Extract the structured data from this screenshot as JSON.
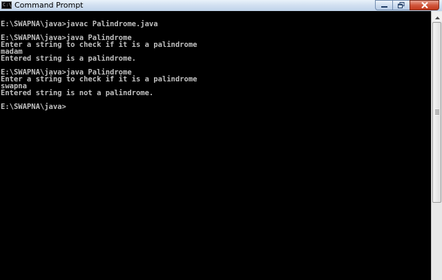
{
  "window": {
    "title": "Command Prompt",
    "icon_text": "C:\\",
    "controls": {
      "minimize_icon": "minimize-icon",
      "maximize_icon": "maximize-icon",
      "close_icon": "close-icon"
    }
  },
  "console": {
    "background": "#000000",
    "foreground": "#c0c0c0",
    "lines": [
      "E:\\SWAPNA\\java>javac Palindrome.java",
      "",
      "E:\\SWAPNA\\java>java Palindrome",
      "Enter a string to check if it is a palindrome",
      "madam",
      "Entered string is a palindrome.",
      "",
      "E:\\SWAPNA\\java>java Palindrome",
      "Enter a string to check if it is a palindrome",
      "swapna",
      "Entered string is not a palindrome.",
      "",
      "E:\\SWAPNA\\java>"
    ]
  },
  "scrollbar": {
    "up_arrow_icon": "scroll-up-arrow-icon"
  }
}
